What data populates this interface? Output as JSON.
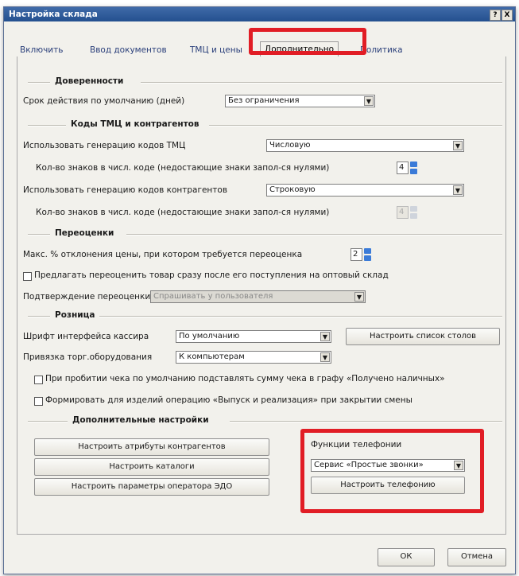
{
  "window": {
    "title": "Настройка склада",
    "help_icon": "?",
    "close_icon": "X"
  },
  "tabs": [
    {
      "label": "Включить"
    },
    {
      "label": "Ввод документов"
    },
    {
      "label": "ТМЦ и цены"
    },
    {
      "label": "Дополнительно"
    },
    {
      "label": "Политика"
    }
  ],
  "sections": {
    "power": "Доверенности",
    "codes": "Коды ТМЦ и контрагентов",
    "reval": "Переоценки",
    "retail": "Розница",
    "extra": "Дополнительные настройки"
  },
  "power": {
    "term_label": "Срок действия по умолчанию (дней)",
    "term_value": "Без ограничения"
  },
  "codes": {
    "gen_tmc_label": "Использовать генерацию кодов ТМЦ",
    "gen_tmc_value": "Числовую",
    "digits_label_1": "Кол-во знаков в числ. коде (недостающие знаки запол-ся нулями)",
    "digits_value_1": "4",
    "gen_contr_label": "Использовать генерацию кодов контрагентов",
    "gen_contr_value": "Строковую",
    "digits_label_2": "Кол-во знаков в числ. коде (недостающие знаки запол-ся нулями)",
    "digits_value_2": "4"
  },
  "reval": {
    "max_label": "Макс. % отклонения цены, при котором требуется переоценка",
    "max_value": "2",
    "offer_label": "Предлагать переоценить товар сразу после его поступления на оптовый склад",
    "confirm_label": "Подтверждение переоценки",
    "confirm_value": "Спрашивать у пользователя"
  },
  "retail": {
    "font_label": "Шрифт интерфейса кассира",
    "font_value": "По умолчанию",
    "tables_button": "Настроить список столов",
    "bind_label": "Привязка торг.оборудования",
    "bind_value": "К компьютерам",
    "substitute_label": "При пробитии чека по умолчанию подставлять сумму чека в графу «Получено наличных»",
    "form_label": "Формировать для изделий операцию «Выпуск и реализация» при закрытии смены"
  },
  "extra": {
    "attr_button": "Настроить атрибуты контрагентов",
    "catalogs_button": "Настроить каталоги",
    "edo_button": "Настроить параметры оператора ЭДО",
    "telephony_label": "Функции телефонии",
    "telephony_value": "Сервис «Простые звонки»",
    "telephony_button": "Настроить телефонию"
  },
  "footer": {
    "ok": "ОК",
    "cancel": "Отмена"
  },
  "colors": {
    "highlight": "#e11d25",
    "titlebar": "#2f5c9b",
    "spinner": "#3b7bd8"
  }
}
